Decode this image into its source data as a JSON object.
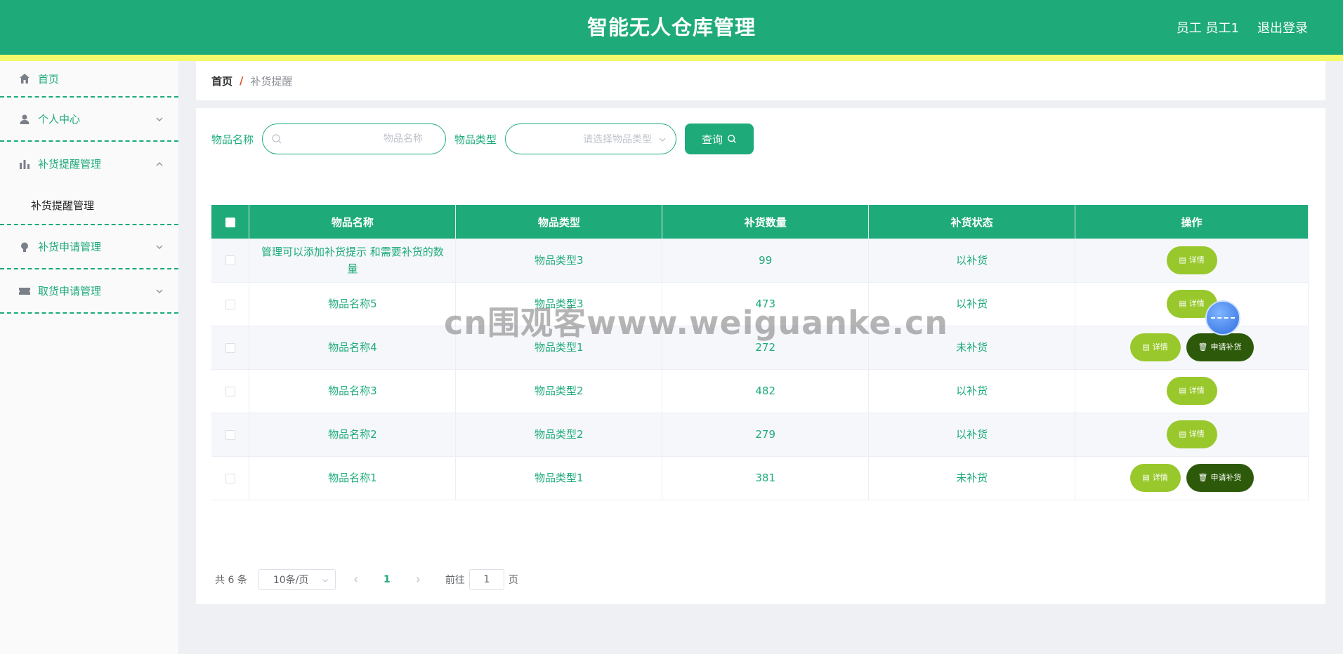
{
  "header": {
    "title": "智能无人仓库管理",
    "user": "员工 员工1",
    "logout": "退出登录"
  },
  "sidebar": {
    "items": [
      {
        "label": "首页",
        "icon": "home-icon"
      },
      {
        "label": "个人中心",
        "icon": "user-icon"
      },
      {
        "label": "补货提醒管理",
        "icon": "bar-chart-icon"
      },
      {
        "label": "补货申请管理",
        "icon": "lightbulb-icon"
      },
      {
        "label": "取货申请管理",
        "icon": "ticket-icon"
      }
    ],
    "submenu": {
      "label": "补货提醒管理"
    }
  },
  "breadcrumb": {
    "home": "首页",
    "separator": "/",
    "current": "补货提醒"
  },
  "search": {
    "name_label": "物品名称",
    "name_placeholder": "物品名称",
    "name_value": "",
    "type_label": "物品类型",
    "type_placeholder": "请选择物品类型",
    "query_label": "查询"
  },
  "table": {
    "headers": [
      "物品名称",
      "物品类型",
      "补货数量",
      "补货状态",
      "操作"
    ],
    "rows": [
      {
        "name": "管理可以添加补货提示 和需要补货的数量",
        "type": "物品类型3",
        "qty": "99",
        "status": "以补货"
      },
      {
        "name": "物品名称5",
        "type": "物品类型3",
        "qty": "473",
        "status": "以补货"
      },
      {
        "name": "物品名称4",
        "type": "物品类型1",
        "qty": "272",
        "status": "未补货"
      },
      {
        "name": "物品名称3",
        "type": "物品类型2",
        "qty": "482",
        "status": "以补货"
      },
      {
        "name": "物品名称2",
        "type": "物品类型2",
        "qty": "279",
        "status": "以补货"
      },
      {
        "name": "物品名称1",
        "type": "物品类型1",
        "qty": "381",
        "status": "未补货"
      }
    ],
    "detail_label": "详情",
    "apply_label": "申请补货"
  },
  "pagination": {
    "total": "共 6 条",
    "page_size": "10条/页",
    "current_page": "1",
    "goto_prefix": "前往",
    "goto_value": "1",
    "goto_suffix": "页"
  },
  "watermark": "cn围观客www.weiguanke.cn",
  "colors": {
    "primary": "#1eab79",
    "stripe": "#f4f86a",
    "detail_button": "#98c82b",
    "apply_button": "#2d5a0a"
  }
}
